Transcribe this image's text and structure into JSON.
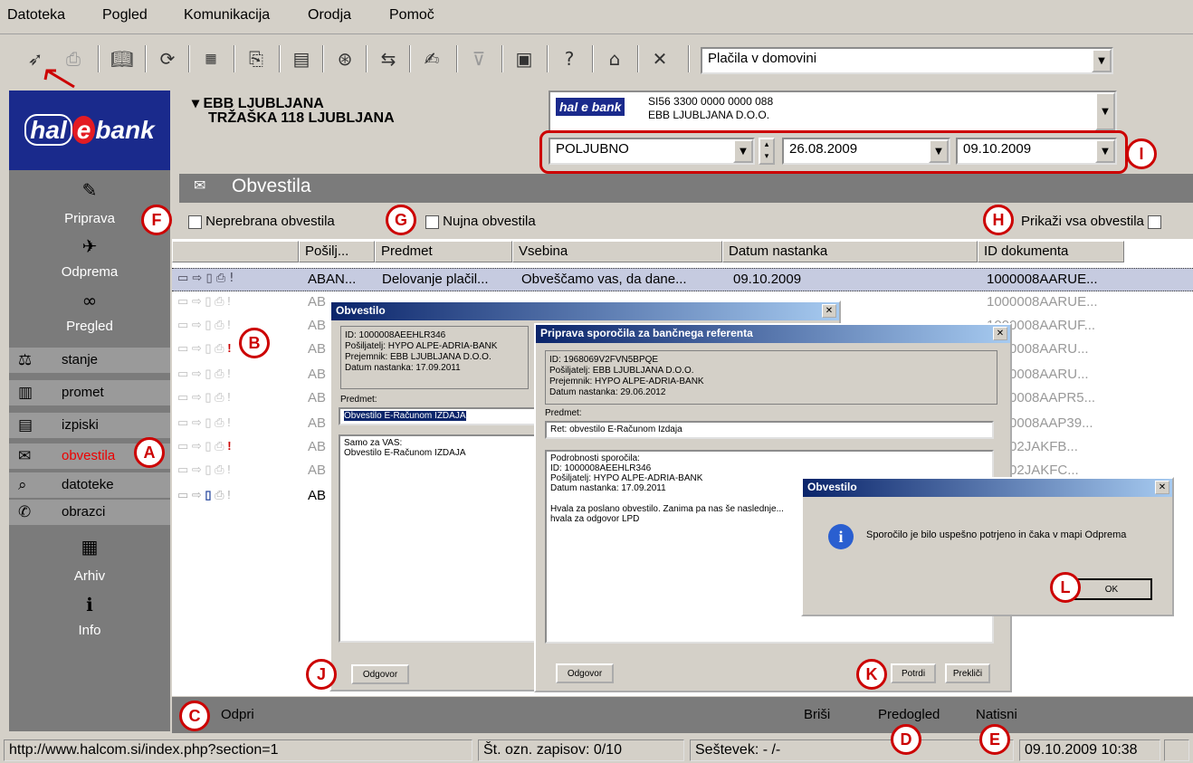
{
  "menu": [
    "Datoteka",
    "Pogled",
    "Komunikacija",
    "Orodja",
    "Pomoč"
  ],
  "toolbar": {
    "combo_value": "Plačila v domovini",
    "icons": [
      "send-icon",
      "print-icon",
      "book-icon",
      "refresh-icon",
      "binary-icon",
      "stamp-icon",
      "form-icon",
      "currency-icon",
      "transfer-icon",
      "edit-icon",
      "filter-icon",
      "calculator-icon",
      "help-icon",
      "hat-icon",
      "close-icon"
    ]
  },
  "bank": {
    "name": "EBB LJUBLJANA",
    "address": "TRŽAŠKA 118 LJUBLJANA",
    "account": "SI56 3300 0000 0000 088",
    "account_name": "EBB LJUBLJANA D.O.O.",
    "period": "POLJUBNO",
    "date_from": "26.08.2009",
    "date_to": "09.10.2009",
    "logo": "hal e bank"
  },
  "nav": {
    "big": [
      {
        "label": "Priprava",
        "icon": "✎"
      },
      {
        "label": "Odprema",
        "icon": "✈"
      },
      {
        "label": "Pregled",
        "icon": "∞"
      }
    ],
    "small": [
      {
        "label": "stanje",
        "icon": "⚖"
      },
      {
        "label": "promet",
        "icon": "▥"
      },
      {
        "label": "izpiski",
        "icon": "▤"
      },
      {
        "label": "obvestila",
        "icon": "✉"
      },
      {
        "label": "datoteke",
        "icon": "⌕"
      },
      {
        "label": "obrazci",
        "icon": "✆"
      }
    ],
    "big2": [
      {
        "label": "Arhiv",
        "icon": "▦"
      },
      {
        "label": "Info",
        "icon": "ℹ"
      }
    ]
  },
  "section": {
    "title": "Obvestila"
  },
  "filters": {
    "unread": "Neprebrana obvestila",
    "urgent": "Nujna obvestila",
    "show_all": "Prikaži vsa obvestila"
  },
  "columns": [
    "Pošilj...",
    "Predmet",
    "Vsebina",
    "Datum nastanka",
    "ID dokumenta"
  ],
  "rows": [
    {
      "sender": "ABAN...",
      "subject": "Delovanje plačil...",
      "content": "Obveščamo vas, da dane...",
      "date": "09.10.2009",
      "id": "1000008AARUE..."
    },
    {
      "sender": "AB",
      "subject": "",
      "content": "",
      "date": "",
      "id": "1000008AARUE..."
    },
    {
      "sender": "AB",
      "subject": "",
      "content": "",
      "date": "",
      "id": "1000008AARUF..."
    },
    {
      "sender": "AB",
      "subject": "",
      "content": "",
      "date": "",
      "id": "1000008AARU..."
    },
    {
      "sender": "AB",
      "subject": "",
      "content": "",
      "date": "",
      "id": "1000008AARU..."
    },
    {
      "sender": "AB",
      "subject": "",
      "content": "",
      "date": "",
      "id": "1000008AAPR5..."
    },
    {
      "sender": "AB",
      "subject": "",
      "content": "",
      "date": "",
      "id": "1000008AAP39..."
    },
    {
      "sender": "AB",
      "subject": "",
      "content": "",
      "date": "",
      "id": "10002JAKFB..."
    },
    {
      "sender": "AB",
      "subject": "",
      "content": "",
      "date": "",
      "id": "10002JAKFC..."
    },
    {
      "sender": "AB",
      "subject": "",
      "content": "",
      "date": "",
      "id": ""
    }
  ],
  "dialog1": {
    "title": "Obvestilo",
    "meta": [
      "ID: 1000008AEEHLR346",
      "Pošiljatelj: HYPO ALPE-ADRIA-BANK",
      "Prejemnik: EBB LJUBLJANA D.O.O.",
      "Datum nastanka: 17.09.2011"
    ],
    "subject_label": "Predmet:",
    "subject": "Obvestilo E-Računom IZDAJA",
    "body": [
      "Samo za VAS:",
      "Obvestilo E-Računom IZDAJA"
    ],
    "reply": "Odgovor"
  },
  "dialog2": {
    "title": "Priprava sporočila za bančnega referenta",
    "meta": [
      "ID: 1968069V2FVN5BPQE",
      "Pošiljatelj: EBB LJUBLJANA D.O.O.",
      "Prejemnik: HYPO ALPE-ADRIA-BANK",
      "Datum nastanka: 29.06.2012"
    ],
    "subject_label": "Predmet:",
    "subject": "Ret: obvestilo E-Računom Izdaja",
    "body": [
      "Podrobnosti sporočila:",
      "ID: 1000008AEEHLR346",
      "Pošiljatelj: HYPO ALPE-ADRIA-BANK",
      "Datum nastanka: 17.09.2011",
      "",
      "Hvala za poslano obvestilo. Zanima pa nas še naslednje...",
      "hvala za odgovor LPD"
    ],
    "reply": "Odgovor",
    "confirm": "Potrdi",
    "cancel": "Prekliči"
  },
  "dialog3": {
    "title": "Obvestilo",
    "message": "Sporočilo je bilo uspešno potrjeno in čaka v mapi Odprema",
    "ok": "OK"
  },
  "bottom": {
    "open": "Odpri",
    "delete": "Briši",
    "preview": "Predogled",
    "print": "Natisni"
  },
  "status": {
    "url": "http://www.halcom.si/index.php?section=1",
    "count": "Št. ozn. zapisov: 0/10",
    "sum": "Seštevek: - /-",
    "datetime": "09.10.2009 10:38"
  },
  "callouts": [
    "A",
    "B",
    "C",
    "D",
    "E",
    "F",
    "G",
    "H",
    "I",
    "J",
    "K",
    "L"
  ]
}
